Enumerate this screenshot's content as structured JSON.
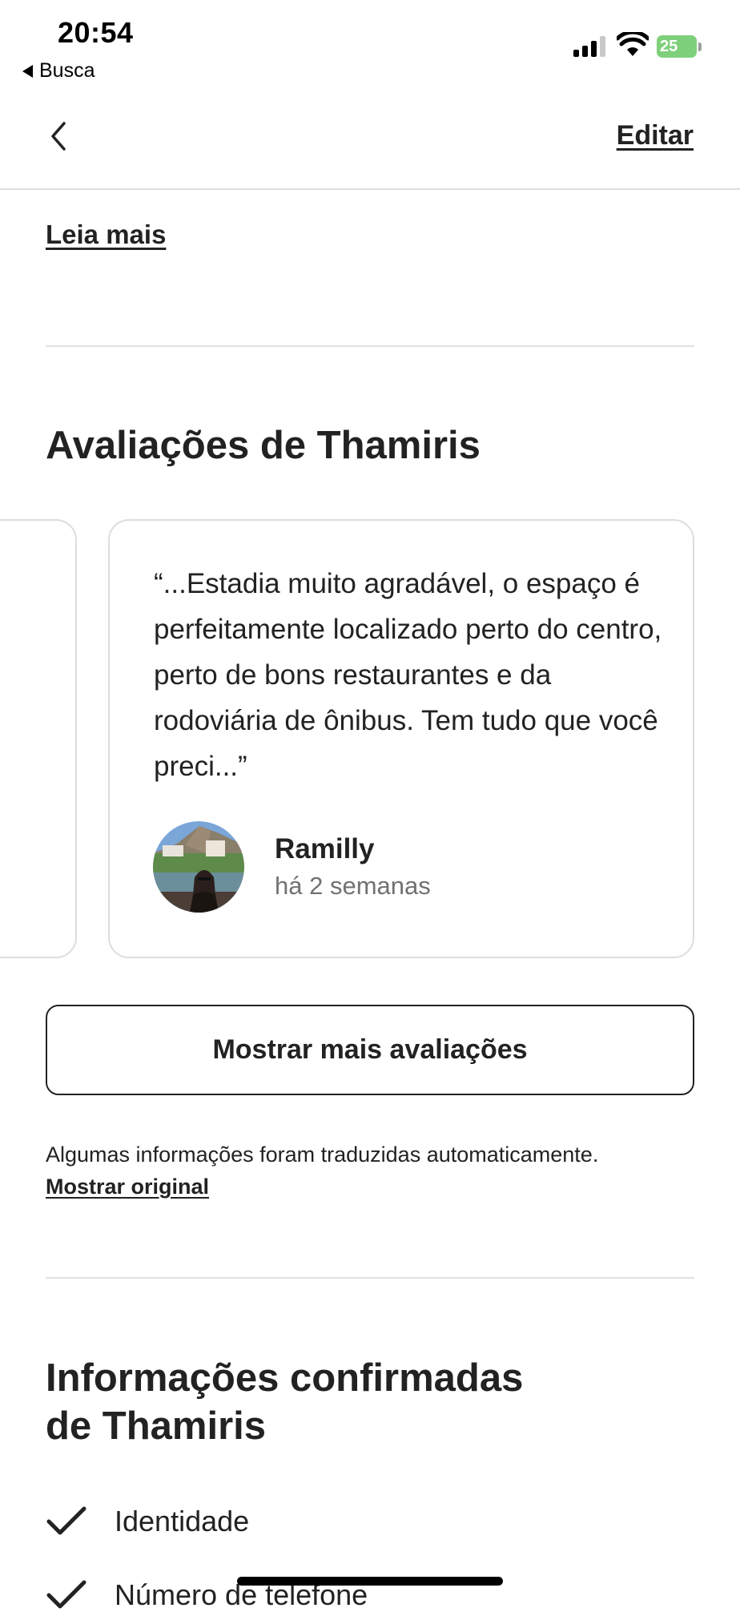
{
  "status_bar": {
    "time": "20:54",
    "back_app": "Busca",
    "battery": "25"
  },
  "nav": {
    "edit_label": "Editar"
  },
  "read_more": "Leia mais",
  "reviews": {
    "heading": "Avaliações de Thamiris",
    "items": [
      {
        "text": "“...Estadia muito agradável, o espaço é perfeitamente localizado perto do centro, perto de bons restaurantes e da rodoviária de ônibus. Tem tudo que você preci...”",
        "author": "Ramilly",
        "date": "há 2 semanas"
      }
    ],
    "show_more_label": "Mostrar mais avaliações"
  },
  "translation": {
    "note": "Algumas informações foram traduzidas automaticamente.",
    "show_original": "Mostrar original"
  },
  "confirmed": {
    "heading_line1": "Informações confirmadas",
    "heading_line2": "de Thamiris",
    "items": [
      {
        "label": "Identidade"
      },
      {
        "label": "Número de telefone"
      }
    ]
  }
}
